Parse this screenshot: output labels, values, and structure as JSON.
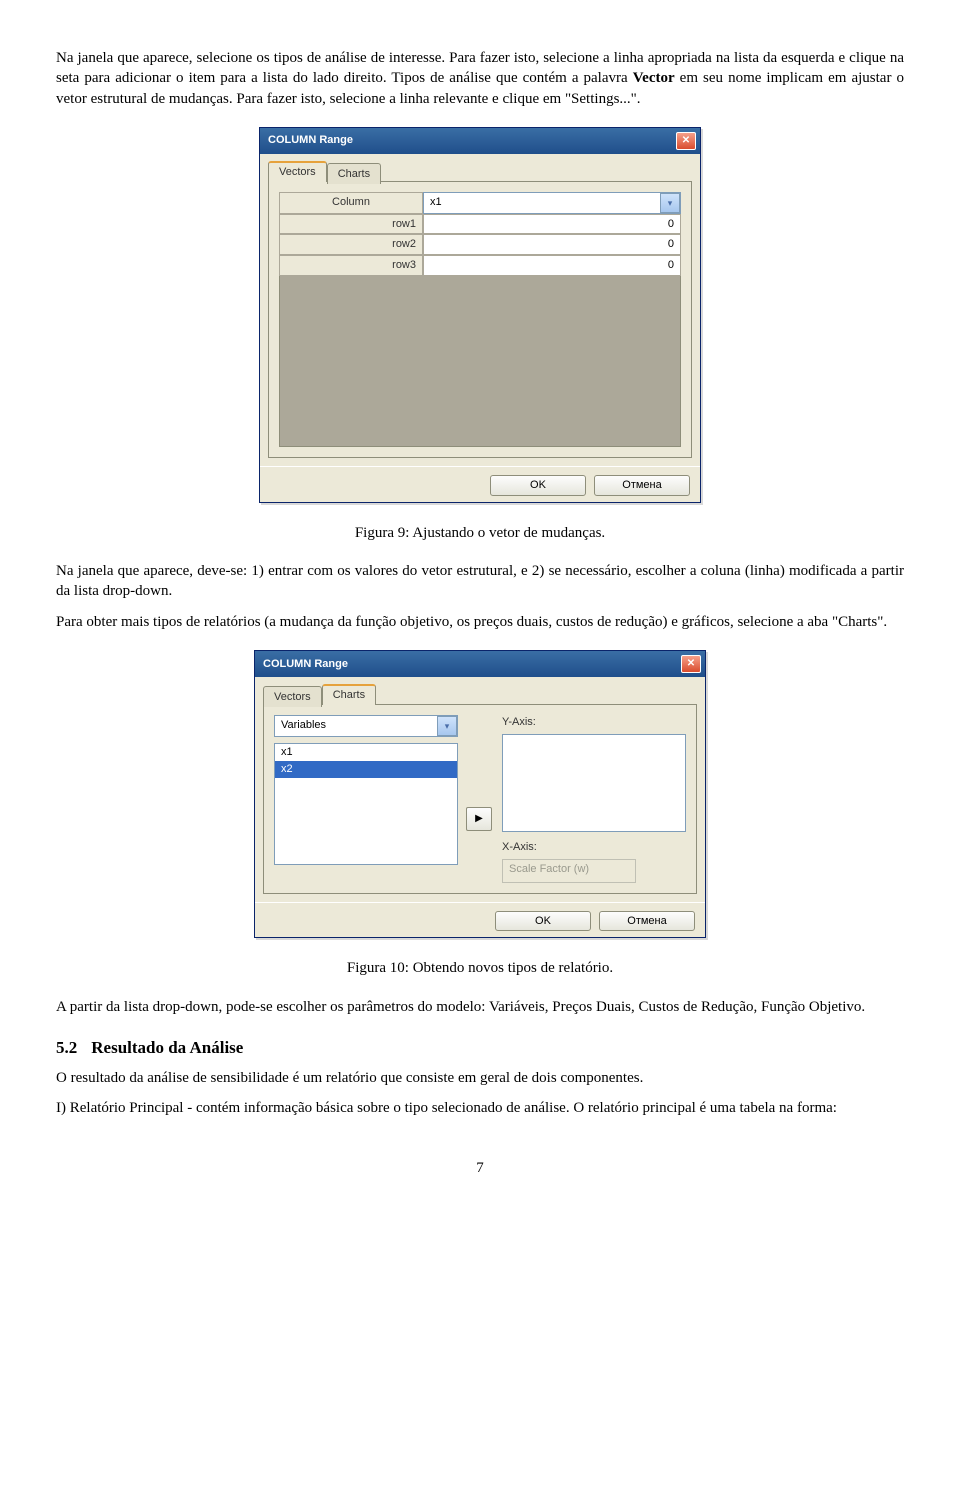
{
  "para1_a": "Na janela que aparece, selecione os tipos de análise de interesse. Para fazer isto, selecione a linha apropriada na lista da esquerda e clique na seta para adicionar o item para a lista do lado direito. Tipos de análise que contém a palavra ",
  "para1_b": "Vector",
  "para1_c": " em seu nome implicam em ajustar o vetor estrutural de mudanças. Para fazer isto, selecione a linha relevante e clique em \"Settings...\".",
  "caption9": "Figura 9: Ajustando o vetor de mudanças.",
  "para2": "Na janela que aparece, deve-se: 1) entrar com os valores do vetor estrutural, e 2) se necessário, escolher a coluna (linha) modificada a partir da lista drop-down.",
  "para3": "Para obter mais tipos de relatórios (a mudança da função objetivo, os preços duais, custos de redução) e gráficos, selecione a aba \"Charts\".",
  "caption10": "Figura 10: Obtendo novos tipos de relatório.",
  "para4": "A partir da lista drop-down, pode-se escolher os parâmetros do modelo: Variáveis, Preços Duais, Custos de Redução, Função Objetivo.",
  "sec_num": "5.2",
  "sec_title": "Resultado da Análise",
  "para5": "O resultado da análise de sensibilidade é um relatório que consiste em geral de dois componentes.",
  "para6": "I) Relatório Principal - contém informação básica sobre o tipo selecionado de análise. O relatório principal é uma tabela na forma:",
  "page_number": "7",
  "dlg": {
    "title": "COLUMN Range",
    "close_glyph": "✕",
    "tab_vectors": "Vectors",
    "tab_charts": "Charts",
    "column_label": "Column",
    "column_value": "x1",
    "rows": {
      "r1_label": "row1",
      "r1_val": "0",
      "r2_label": "row2",
      "r2_val": "0",
      "r3_label": "row3",
      "r3_val": "0"
    },
    "ok": "OK",
    "cancel": "Отмена",
    "variables_label": "Variables",
    "yaxis_label": "Y-Axis:",
    "xaxis_label": "X-Axis:",
    "scale_label": "Scale Factor (w)",
    "list_x1": "x1",
    "list_x2": "x2",
    "arrow_glyph": "▶"
  }
}
